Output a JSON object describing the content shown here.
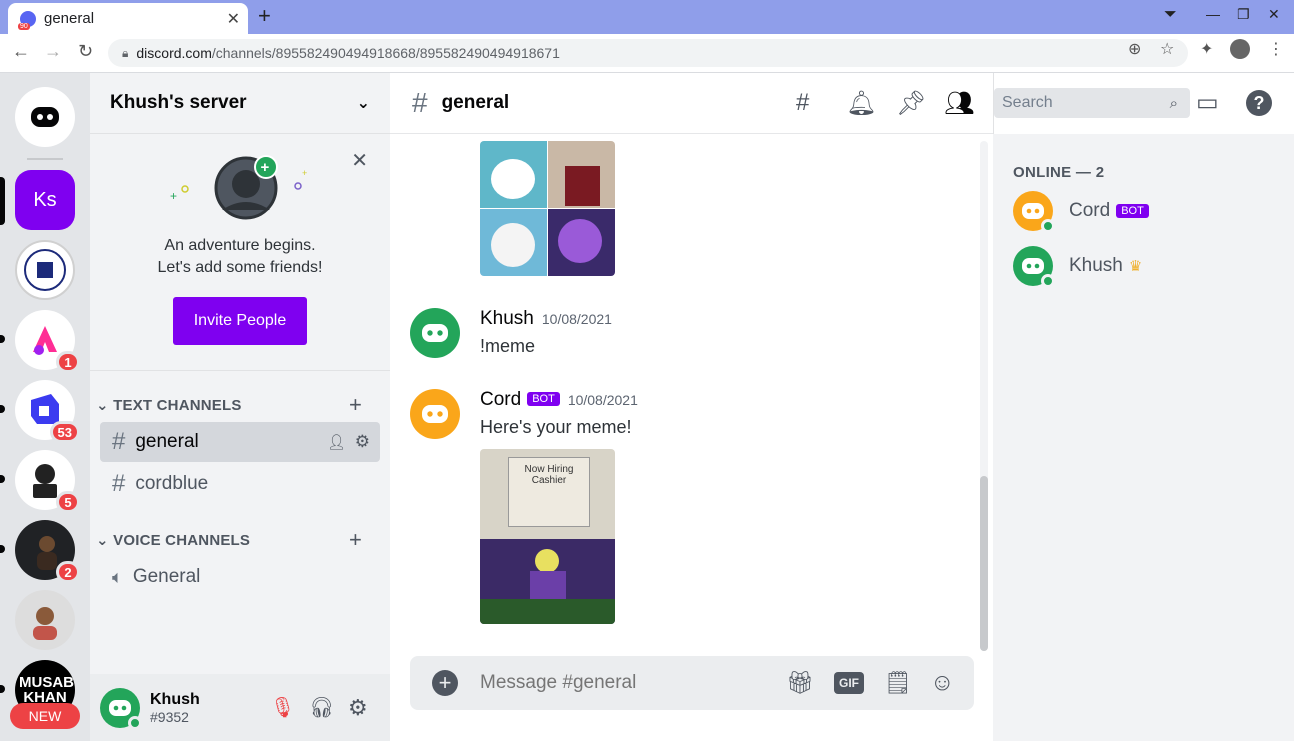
{
  "browser": {
    "tab_title": "general",
    "tab_badge": "90",
    "url_host": "discord.com",
    "url_path": "/channels/895582490494918668/895582490494918671"
  },
  "guilds": {
    "items": [
      {
        "label": "Ks",
        "color": "#7f00f0"
      },
      {
        "label": "",
        "color": "#ffffff",
        "badge": ""
      },
      {
        "label": "",
        "color": "#ffffff",
        "badge": "1"
      },
      {
        "label": "",
        "color": "#ffffff",
        "badge": "53"
      },
      {
        "label": "",
        "color": "#ffffff",
        "badge": "5"
      },
      {
        "label": "",
        "color": "#202225",
        "badge": "2"
      },
      {
        "label": "",
        "color": "#cccccc",
        "badge": ""
      },
      {
        "label": "MUSAB KHAN",
        "color": "#000000",
        "badge": ""
      }
    ],
    "new_label": "NEW"
  },
  "server": {
    "name": "Khush's server",
    "invite_line1": "An adventure begins.",
    "invite_line2": "Let's add some friends!",
    "invite_button": "Invite People",
    "text_category": "TEXT CHANNELS",
    "voice_category": "VOICE CHANNELS",
    "text_channels": [
      "general",
      "cordblue"
    ],
    "voice_channels": [
      "General"
    ]
  },
  "user": {
    "name": "Khush",
    "tag": "#9352"
  },
  "channel": {
    "name": "general",
    "search_placeholder": "Search",
    "composer_placeholder": "Message #general",
    "gif_label": "GIF"
  },
  "messages": [
    {
      "author": "Khush",
      "timestamp": "10/08/2021",
      "text": "!meme",
      "bot": false
    },
    {
      "author": "Cord",
      "timestamp": "10/08/2021",
      "text": "Here's your meme!",
      "bot": true,
      "bot_label": "BOT"
    }
  ],
  "meme_image": {
    "line1": "Now Hiring",
    "line2": "Cashier"
  },
  "members": {
    "header": "ONLINE — 2",
    "list": [
      {
        "name": "Cord",
        "bot_label": "BOT",
        "color": "#faa61a"
      },
      {
        "name": "Khush",
        "color": "#23a55a"
      }
    ]
  },
  "colors": {
    "brand": "#7f00f0",
    "online": "#23a55a",
    "badge": "#ed4245"
  }
}
